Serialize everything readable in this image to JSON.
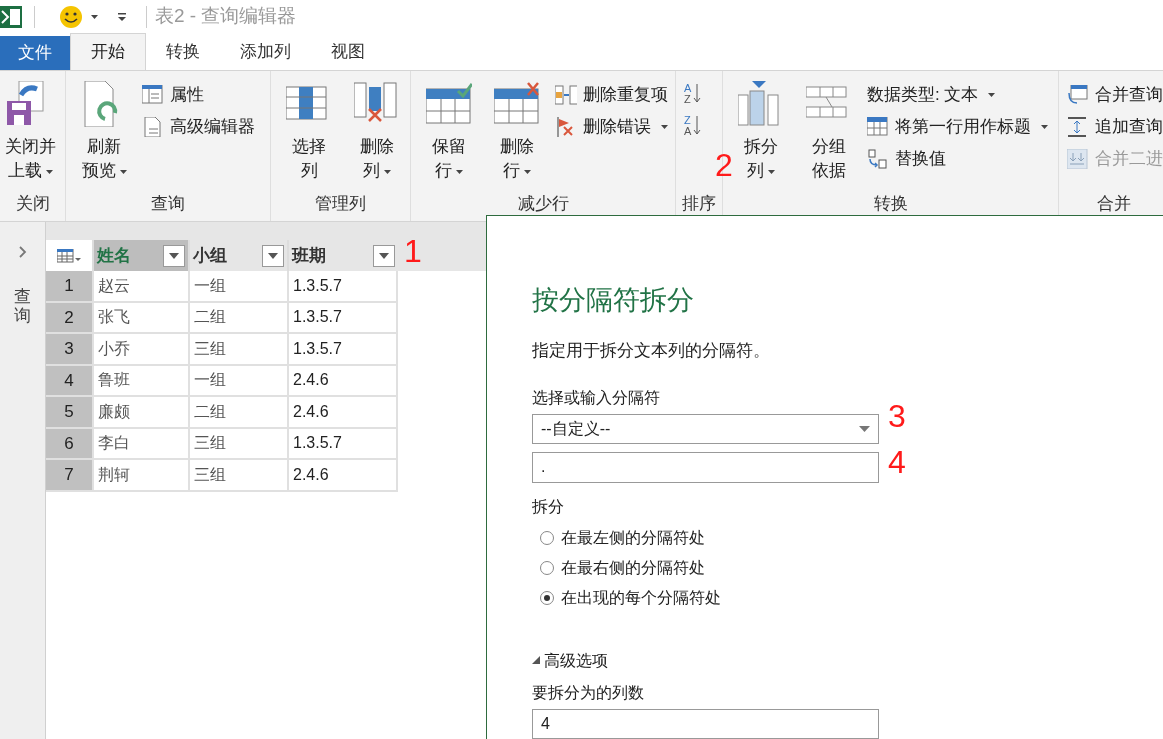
{
  "window": {
    "title": "表2 - 查询编辑器"
  },
  "tabs": [
    {
      "label": "文件",
      "kind": "file",
      "selected": false
    },
    {
      "label": "开始",
      "kind": "tab",
      "selected": true
    },
    {
      "label": "转换",
      "kind": "tab",
      "selected": false
    },
    {
      "label": "添加列",
      "kind": "tab",
      "selected": false
    },
    {
      "label": "视图",
      "kind": "tab",
      "selected": false
    }
  ],
  "ribbon": {
    "groups": [
      {
        "label": "关闭",
        "items": [
          {
            "kind": "large",
            "lines": [
              "关闭并",
              "上载"
            ],
            "dropdown": true
          }
        ]
      },
      {
        "label": "查询",
        "items": [
          {
            "kind": "large",
            "lines": [
              "刷新",
              "预览"
            ],
            "dropdown": true
          },
          {
            "kind": "small",
            "label": "属性",
            "dropdown": false,
            "disabled": false
          },
          {
            "kind": "small",
            "label": "高级编辑器",
            "dropdown": false,
            "disabled": false
          }
        ]
      },
      {
        "label": "管理列",
        "items": [
          {
            "kind": "large",
            "lines": [
              "选择",
              "列"
            ],
            "dropdown": false
          },
          {
            "kind": "large",
            "lines": [
              "删除",
              "列"
            ],
            "dropdown": true
          }
        ]
      },
      {
        "label": "减少行",
        "items": [
          {
            "kind": "large",
            "lines": [
              "保留",
              "行"
            ],
            "dropdown": true
          },
          {
            "kind": "large",
            "lines": [
              "删除",
              "行"
            ],
            "dropdown": true
          },
          {
            "kind": "small",
            "label": "删除重复项",
            "dropdown": false,
            "disabled": false
          },
          {
            "kind": "small",
            "label": "删除错误",
            "dropdown": true,
            "disabled": false
          }
        ]
      },
      {
        "label": "排序",
        "items": [
          {
            "kind": "sort",
            "letters": [
              "A",
              "Z"
            ]
          },
          {
            "kind": "sort",
            "letters": [
              "Z",
              "A"
            ]
          }
        ]
      },
      {
        "label": "转换",
        "items": [
          {
            "kind": "large",
            "lines": [
              "拆分",
              "列"
            ],
            "dropdown": true
          },
          {
            "kind": "large",
            "lines": [
              "分组",
              "依据"
            ],
            "dropdown": false
          },
          {
            "kind": "small",
            "label": "数据类型: 文本",
            "dropdown": true,
            "disabled": false
          },
          {
            "kind": "small",
            "label": "将第一行用作标题",
            "dropdown": true,
            "disabled": false
          },
          {
            "kind": "small",
            "label": "替换值",
            "dropdown": false,
            "disabled": false
          }
        ]
      },
      {
        "label": "合并",
        "items": [
          {
            "kind": "small",
            "label": "合并查询",
            "disabled": false
          },
          {
            "kind": "small",
            "label": "追加查询",
            "disabled": false
          },
          {
            "kind": "small",
            "label": "合并二进",
            "disabled": true
          }
        ]
      }
    ]
  },
  "queries_pane": {
    "label": "查询",
    "expanded": false
  },
  "table": {
    "columns": [
      {
        "name": "姓名",
        "selected": true
      },
      {
        "name": "小组",
        "selected": false
      },
      {
        "name": "班期",
        "selected": false
      }
    ],
    "rows": [
      {
        "index": "1",
        "cells": [
          "赵云",
          "一组",
          "1.3.5.7"
        ]
      },
      {
        "index": "2",
        "cells": [
          "张飞",
          "二组",
          "1.3.5.7"
        ]
      },
      {
        "index": "3",
        "cells": [
          "小乔",
          "三组",
          "1.3.5.7"
        ]
      },
      {
        "index": "4",
        "cells": [
          "鲁班",
          "一组",
          "2.4.6"
        ]
      },
      {
        "index": "5",
        "cells": [
          "廉颇",
          "二组",
          "2.4.6"
        ]
      },
      {
        "index": "6",
        "cells": [
          "李白",
          "三组",
          "1.3.5.7"
        ]
      },
      {
        "index": "7",
        "cells": [
          "荆轲",
          "三组",
          "2.4.6"
        ]
      }
    ]
  },
  "dialog": {
    "title": "按分隔符拆分",
    "description": "指定用于拆分文本列的分隔符。",
    "delimiter_label": "选择或输入分隔符",
    "delimiter_choice": "--自定义--",
    "delimiter_value": ".",
    "split_label": "拆分",
    "split_options": [
      {
        "label": "在最左侧的分隔符处",
        "selected": false
      },
      {
        "label": "在最右侧的分隔符处",
        "selected": false
      },
      {
        "label": "在出现的每个分隔符处",
        "selected": true
      }
    ],
    "advanced": {
      "label": "高级选项",
      "expanded": true
    },
    "columns_label": "要拆分为的列数",
    "columns_value": "4"
  },
  "annotations": [
    "1",
    "2",
    "3",
    "4"
  ]
}
